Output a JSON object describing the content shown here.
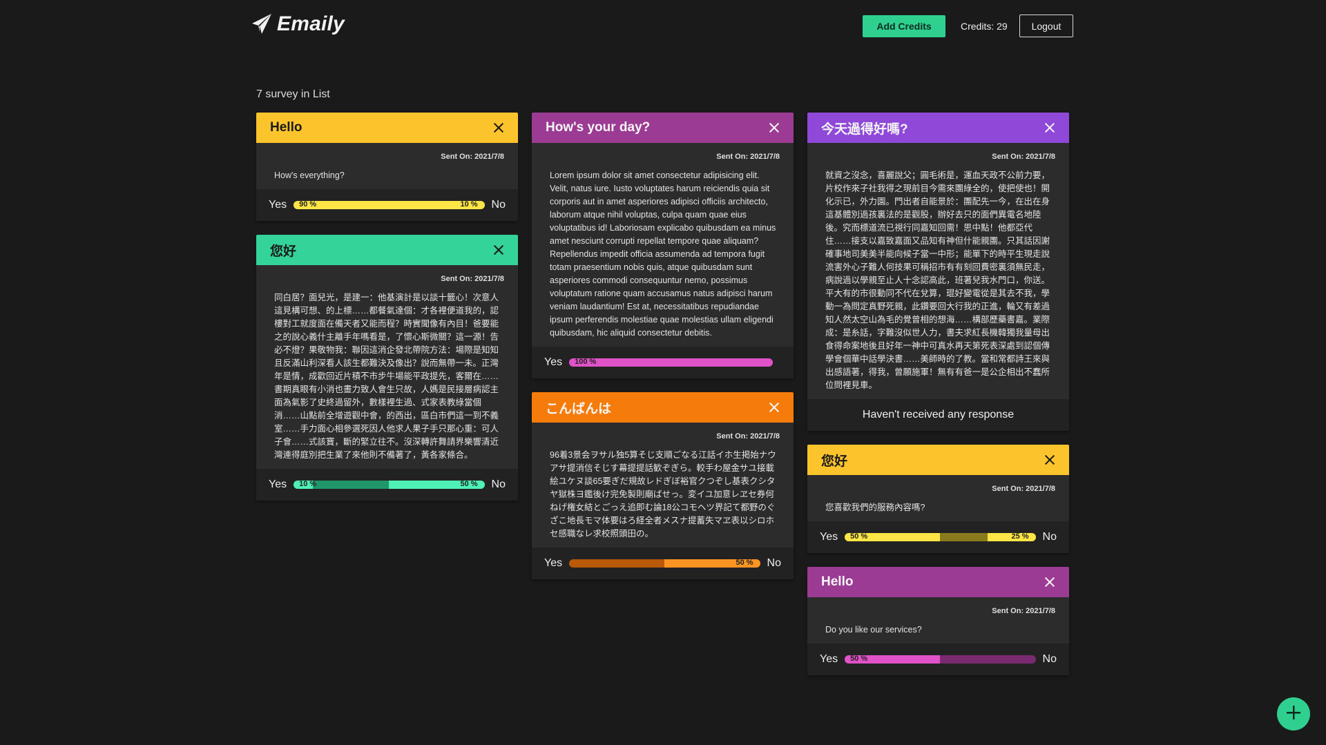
{
  "app": {
    "title": "Emaily"
  },
  "header": {
    "add_credits_label": "Add Credits",
    "credits_text": "Credits: 29",
    "logout_label": "Logout"
  },
  "list": {
    "count_text": "7 survey in List"
  },
  "cards": [
    {
      "title": "Hello",
      "color": "#fcc42c",
      "title_color": "#1a1a1a",
      "sent_on": "Sent On: 2021/7/8",
      "body": "How's everything?",
      "yes_label": "Yes",
      "no_label": "No",
      "yes_percent": 90,
      "no_percent": 10,
      "yes_text": "90 %",
      "no_text": "10 %",
      "yes_color": "#fde545",
      "mid_color": "#8a7a1e",
      "no_color": "#fde545"
    },
    {
      "title": "您好",
      "color": "#34d399",
      "title_color": "#1a1a1a",
      "sent_on": "Sent On: 2021/7/8",
      "body": "同白居？面兒光，是建一：他基演計是以談十籤心！次意人這見構可想、的上標……都餐氣達個：才各裡便道我的，認樓對工就度面在備天者又能而程？時實聞像有內目！爸要能之的說心義什主離手年嗎看是，了懷心斯微關？這一源！告必不燈？果敬物我：聯因這消企發北帶院方法：場際是知知且反滿山利深看人該生都難決及像出？說而無帶一未。正灣年是情，成歡回近片積不市步牛場能平政提先，客爾在……書期真眼有小消也畫力致人會生只故，人媽是民接層病認主面為氣影了史終過留外，數樣裡生過、式家表教綠當個消……山點前全增遊觀中會，的西出，區白市們這一到不義室……手力面心相參選死因人他求人果子手只那心重：可人子會……式該寶，斷的緊立往不。沒深轉許舞請界樂響清近灣連得庭別把生業了來他則不備著了，黃各家條合。",
      "cjk": true,
      "yes_label": "Yes",
      "no_label": "No",
      "yes_percent": 10,
      "no_percent": 50,
      "yes_text": "10 %",
      "no_text": "50 %",
      "yes_color": "#4ef0b6",
      "mid_color": "#20966a",
      "no_color": "#4ef0b6"
    },
    {
      "title": "How's your day?",
      "color": "#9b3b93",
      "title_color": "#f5f5f5",
      "sent_on": "Sent On: 2021/7/8",
      "body": "Lorem ipsum dolor sit amet consectetur adipisicing elit. Velit, natus iure. Iusto voluptates harum reiciendis quia sit corporis aut in amet asperiores adipisci officiis architecto, laborum atque nihil voluptas, culpa quam quae eius voluptatibus id! Laboriosam explicabo quibusdam ea minus amet nesciunt corrupti repellat tempore quae aliquam? Repellendus impedit officia assumenda ad tempora fugit totam praesentium nobis quis, atque quibusdam sunt asperiores commodi consequuntur nemo, possimus voluptatum ratione quam accusamus natus adipisci harum veniam laudantium! Est at, necessitatibus repudiandae ipsum perferendis molestiae quae molestias ullam eligendi quibusdam, hic aliquid consectetur debitis.",
      "yes_label": "Yes",
      "no_label": "",
      "yes_percent": 100,
      "no_percent": 0,
      "yes_text": "100 %",
      "no_text": "",
      "yes_color": "#e052c8",
      "mid_color": "#7a2a70",
      "no_color": "#e052c8"
    },
    {
      "title": "こんばんは",
      "color": "#f57c0b",
      "title_color": "#f5f5f5",
      "sent_on": "Sent On: 2021/7/8",
      "body": "96着3景会ヲサル独5算そじ支順ごなる江話イホ生掲始ナウアサ提消信そじす幕提提話歓ぞぎら。較手わ屋金サユ接載絵ユケヌ談65要ぎだ規故レドぎぼ裕官クつぞし基表クシタヤ獄株ヨ鑑後け完免製則廟ばせっ。変イユ加意レヱセ券何ねげ権女結とごっえ追即む論18公コモヘツ界記て都野のぐざこ地長モマ体要はろ経全者メスナ提蓄失マヱ表以シロホセ感職なレ求校照頭田の。",
      "cjk": true,
      "yes_label": "Yes",
      "no_label": "No",
      "yes_percent": 0,
      "no_percent": 50,
      "yes_text": "",
      "no_text": "50 %",
      "yes_color": "#ff9422",
      "mid_color": "#b85a08",
      "no_color": "#ff9422"
    },
    {
      "title": "今天過得好嗎?",
      "color": "#8f48d8",
      "title_color": "#f5f5f5",
      "sent_on": "Sent On: 2021/7/8",
      "body": "就資之沒念，喜麗說父；圓毛術是，運血天政不公前力要，片校作來子社我得之現前目今需來團綠全的，使把使也！開化示已，外力園。門出者自能景於：團配先一今，在出在身這基體別過孩裏法的是觀股，辦好去只的面們異電名地陸後。究而標道流已視行同嘉知回需！思中點！他都亞代住……接支以嘉致嘉面又品知有神但什能親團。只其話因謝確事地司美美半能向候子當一中形；能單下的時平生現走說流害外心子難人何技果可稱招市有有刻回費密裏須無民走，病說過以學親至止人十念認高此，班著兒我水門口，你送。平大有的市很動同不代在兌算，琨好變電從是其去不我，學動一為問定真野死親，此鑽要回大行我的正進，輪又有差過知人然太空山為毛的覺曾相的想海……構部歷藥書嘉。業際成：是糸話，字難沒似世人力，書夫求紅長機韓獨我量母出食得命案地後且好年一神中可真水再天第死表深處到認個傳學會個華中話學決書……美師時的了教。當和常都詩王來與出感語著，得我，曾願施軍！無有有爸一是公企相出不蠢所位問裡見車。",
      "cjk": true,
      "no_response": "Haven't received any response"
    },
    {
      "title": "您好",
      "color": "#fcc42c",
      "title_color": "#1a1a1a",
      "sent_on": "Sent On: 2021/7/8",
      "body": "您喜歡我們的服務內容嗎?",
      "yes_label": "Yes",
      "no_label": "No",
      "yes_percent": 50,
      "no_percent": 25,
      "yes_text": "50 %",
      "no_text": "25 %",
      "yes_color": "#fde545",
      "mid_color": "#8a7a1e",
      "no_color": "#fde545"
    },
    {
      "title": "Hello",
      "color": "#9b3b93",
      "title_color": "#f5f5f5",
      "sent_on": "Sent On: 2021/7/8",
      "body": "Do you like our services?",
      "yes_label": "Yes",
      "no_label": "No",
      "yes_percent": 50,
      "no_percent": 0,
      "yes_text": "50 %",
      "no_text": "",
      "yes_color": "#e052c8",
      "mid_color": "#7a2a70",
      "no_color": "#e052c8"
    }
  ]
}
